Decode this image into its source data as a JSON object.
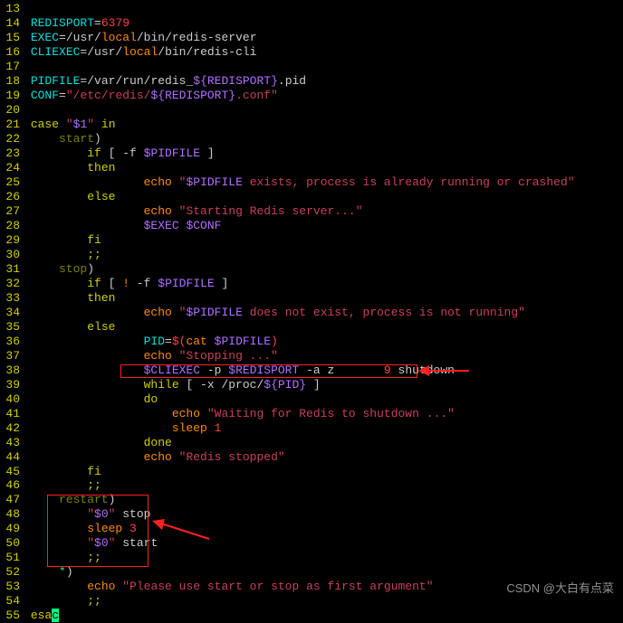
{
  "lines": [
    {
      "n": "13",
      "spans": []
    },
    {
      "n": "14",
      "spans": [
        {
          "t": " ",
          "c": "c-default"
        },
        {
          "t": "REDISPORT",
          "c": "c-cyan"
        },
        {
          "t": "=",
          "c": "c-default"
        },
        {
          "t": "6379",
          "c": "c-red"
        }
      ]
    },
    {
      "n": "15",
      "spans": [
        {
          "t": " ",
          "c": "c-default"
        },
        {
          "t": "EXEC",
          "c": "c-cyan"
        },
        {
          "t": "=",
          "c": "c-default"
        },
        {
          "t": "/usr/",
          "c": "c-default"
        },
        {
          "t": "local",
          "c": "c-orange"
        },
        {
          "t": "/bin/redis-server",
          "c": "c-default"
        }
      ]
    },
    {
      "n": "16",
      "spans": [
        {
          "t": " ",
          "c": "c-default"
        },
        {
          "t": "CLIEXEC",
          "c": "c-cyan"
        },
        {
          "t": "=",
          "c": "c-default"
        },
        {
          "t": "/usr/",
          "c": "c-default"
        },
        {
          "t": "local",
          "c": "c-orange"
        },
        {
          "t": "/bin/redis-cli",
          "c": "c-default"
        }
      ]
    },
    {
      "n": "17",
      "spans": []
    },
    {
      "n": "18",
      "spans": [
        {
          "t": " ",
          "c": "c-default"
        },
        {
          "t": "PIDFILE",
          "c": "c-cyan"
        },
        {
          "t": "=",
          "c": "c-default"
        },
        {
          "t": "/var/run/redis_",
          "c": "c-default"
        },
        {
          "t": "${REDISPORT}",
          "c": "c-purple"
        },
        {
          "t": ".pid",
          "c": "c-default"
        }
      ]
    },
    {
      "n": "19",
      "spans": [
        {
          "t": " ",
          "c": "c-default"
        },
        {
          "t": "CONF",
          "c": "c-cyan"
        },
        {
          "t": "=",
          "c": "c-default"
        },
        {
          "t": "\"/etc/redis/",
          "c": "c-string"
        },
        {
          "t": "${REDISPORT}",
          "c": "c-purple"
        },
        {
          "t": ".conf\"",
          "c": "c-string"
        }
      ]
    },
    {
      "n": "20",
      "spans": []
    },
    {
      "n": "21",
      "spans": [
        {
          "t": " ",
          "c": "c-default"
        },
        {
          "t": "case",
          "c": "c-yellow"
        },
        {
          "t": " ",
          "c": "c-default"
        },
        {
          "t": "\"",
          "c": "c-string"
        },
        {
          "t": "$1",
          "c": "c-purple"
        },
        {
          "t": "\"",
          "c": "c-string"
        },
        {
          "t": " ",
          "c": "c-default"
        },
        {
          "t": "in",
          "c": "c-yellow"
        }
      ]
    },
    {
      "n": "22",
      "spans": [
        {
          "t": "     ",
          "c": "c-default"
        },
        {
          "t": "start",
          "c": "c-olive"
        },
        {
          "t": ")",
          "c": "c-default"
        }
      ]
    },
    {
      "n": "23",
      "spans": [
        {
          "t": "         ",
          "c": "c-default"
        },
        {
          "t": "if",
          "c": "c-yellow"
        },
        {
          "t": " [ -f ",
          "c": "c-default"
        },
        {
          "t": "$PIDFILE",
          "c": "c-purple"
        },
        {
          "t": " ]",
          "c": "c-default"
        }
      ]
    },
    {
      "n": "24",
      "spans": [
        {
          "t": "         ",
          "c": "c-default"
        },
        {
          "t": "then",
          "c": "c-yellow"
        }
      ]
    },
    {
      "n": "25",
      "spans": [
        {
          "t": "                 ",
          "c": "c-default"
        },
        {
          "t": "echo",
          "c": "c-orange"
        },
        {
          "t": " ",
          "c": "c-default"
        },
        {
          "t": "\"",
          "c": "c-string"
        },
        {
          "t": "$PIDFILE",
          "c": "c-purple"
        },
        {
          "t": " exists, process is already running or crashed\"",
          "c": "c-string"
        }
      ]
    },
    {
      "n": "26",
      "spans": [
        {
          "t": "         ",
          "c": "c-default"
        },
        {
          "t": "else",
          "c": "c-yellow"
        }
      ]
    },
    {
      "n": "27",
      "spans": [
        {
          "t": "                 ",
          "c": "c-default"
        },
        {
          "t": "echo",
          "c": "c-orange"
        },
        {
          "t": " ",
          "c": "c-default"
        },
        {
          "t": "\"Starting Redis server...\"",
          "c": "c-string"
        }
      ]
    },
    {
      "n": "28",
      "spans": [
        {
          "t": "                 ",
          "c": "c-default"
        },
        {
          "t": "$EXEC",
          "c": "c-purple"
        },
        {
          "t": " ",
          "c": "c-default"
        },
        {
          "t": "$CONF",
          "c": "c-purple"
        }
      ]
    },
    {
      "n": "29",
      "spans": [
        {
          "t": "         ",
          "c": "c-default"
        },
        {
          "t": "fi",
          "c": "c-yellow"
        }
      ]
    },
    {
      "n": "30",
      "spans": [
        {
          "t": "         ",
          "c": "c-default"
        },
        {
          "t": ";;",
          "c": "c-yellow"
        }
      ]
    },
    {
      "n": "31",
      "spans": [
        {
          "t": "     ",
          "c": "c-default"
        },
        {
          "t": "stop",
          "c": "c-olive"
        },
        {
          "t": ")",
          "c": "c-default"
        }
      ]
    },
    {
      "n": "32",
      "spans": [
        {
          "t": "         ",
          "c": "c-default"
        },
        {
          "t": "if",
          "c": "c-yellow"
        },
        {
          "t": " [ ",
          "c": "c-default"
        },
        {
          "t": "!",
          "c": "c-orange"
        },
        {
          "t": " -f ",
          "c": "c-default"
        },
        {
          "t": "$PIDFILE",
          "c": "c-purple"
        },
        {
          "t": " ]",
          "c": "c-default"
        }
      ]
    },
    {
      "n": "33",
      "spans": [
        {
          "t": "         ",
          "c": "c-default"
        },
        {
          "t": "then",
          "c": "c-yellow"
        }
      ]
    },
    {
      "n": "34",
      "spans": [
        {
          "t": "                 ",
          "c": "c-default"
        },
        {
          "t": "echo",
          "c": "c-orange"
        },
        {
          "t": " ",
          "c": "c-default"
        },
        {
          "t": "\"",
          "c": "c-string"
        },
        {
          "t": "$PIDFILE",
          "c": "c-purple"
        },
        {
          "t": " does not exist, process is not running\"",
          "c": "c-string"
        }
      ]
    },
    {
      "n": "35",
      "spans": [
        {
          "t": "         ",
          "c": "c-default"
        },
        {
          "t": "else",
          "c": "c-yellow"
        }
      ]
    },
    {
      "n": "36",
      "spans": [
        {
          "t": "                 ",
          "c": "c-default"
        },
        {
          "t": "PID",
          "c": "c-cyan"
        },
        {
          "t": "=",
          "c": "c-default"
        },
        {
          "t": "$(",
          "c": "c-red"
        },
        {
          "t": "cat ",
          "c": "c-orange"
        },
        {
          "t": "$PIDFILE",
          "c": "c-purple"
        },
        {
          "t": ")",
          "c": "c-red"
        }
      ]
    },
    {
      "n": "37",
      "spans": [
        {
          "t": "                 ",
          "c": "c-default"
        },
        {
          "t": "echo",
          "c": "c-orange"
        },
        {
          "t": " ",
          "c": "c-default"
        },
        {
          "t": "\"Stopping ...\"",
          "c": "c-string"
        }
      ]
    },
    {
      "n": "38",
      "spans": [
        {
          "t": "                 ",
          "c": "c-default"
        },
        {
          "t": "$CLIEXEC",
          "c": "c-purple"
        },
        {
          "t": " -p ",
          "c": "c-default"
        },
        {
          "t": "$REDISPORT",
          "c": "c-purple"
        },
        {
          "t": " -a z",
          "c": "c-default"
        },
        {
          "t": "       ",
          "c": "c-default"
        },
        {
          "t": "9",
          "c": "c-red"
        },
        {
          "t": " shutdown",
          "c": "c-default"
        }
      ]
    },
    {
      "n": "39",
      "spans": [
        {
          "t": "                 ",
          "c": "c-default"
        },
        {
          "t": "while",
          "c": "c-yellow"
        },
        {
          "t": " [ -x /proc/",
          "c": "c-default"
        },
        {
          "t": "${PID}",
          "c": "c-purple"
        },
        {
          "t": " ]",
          "c": "c-default"
        }
      ]
    },
    {
      "n": "40",
      "spans": [
        {
          "t": "                 ",
          "c": "c-default"
        },
        {
          "t": "do",
          "c": "c-yellow"
        }
      ]
    },
    {
      "n": "41",
      "spans": [
        {
          "t": "                     ",
          "c": "c-default"
        },
        {
          "t": "echo",
          "c": "c-orange"
        },
        {
          "t": " ",
          "c": "c-default"
        },
        {
          "t": "\"Waiting for Redis to shutdown ...\"",
          "c": "c-string"
        }
      ]
    },
    {
      "n": "42",
      "spans": [
        {
          "t": "                     ",
          "c": "c-default"
        },
        {
          "t": "sleep",
          "c": "c-orange"
        },
        {
          "t": " ",
          "c": "c-default"
        },
        {
          "t": "1",
          "c": "c-red"
        }
      ]
    },
    {
      "n": "43",
      "spans": [
        {
          "t": "                 ",
          "c": "c-default"
        },
        {
          "t": "done",
          "c": "c-yellow"
        }
      ]
    },
    {
      "n": "44",
      "spans": [
        {
          "t": "                 ",
          "c": "c-default"
        },
        {
          "t": "echo",
          "c": "c-orange"
        },
        {
          "t": " ",
          "c": "c-default"
        },
        {
          "t": "\"Redis stopped\"",
          "c": "c-string"
        }
      ]
    },
    {
      "n": "45",
      "spans": [
        {
          "t": "         ",
          "c": "c-default"
        },
        {
          "t": "fi",
          "c": "c-yellow"
        }
      ]
    },
    {
      "n": "46",
      "spans": [
        {
          "t": "         ",
          "c": "c-default"
        },
        {
          "t": ";;",
          "c": "c-yellow"
        }
      ]
    },
    {
      "n": "47",
      "spans": [
        {
          "t": "     ",
          "c": "c-default"
        },
        {
          "t": "restart",
          "c": "c-olive"
        },
        {
          "t": ")",
          "c": "c-default"
        }
      ]
    },
    {
      "n": "48",
      "spans": [
        {
          "t": "         ",
          "c": "c-default"
        },
        {
          "t": "\"",
          "c": "c-string"
        },
        {
          "t": "$0",
          "c": "c-purple"
        },
        {
          "t": "\"",
          "c": "c-string"
        },
        {
          "t": " stop",
          "c": "c-default"
        }
      ]
    },
    {
      "n": "49",
      "spans": [
        {
          "t": "         ",
          "c": "c-default"
        },
        {
          "t": "sleep",
          "c": "c-orange"
        },
        {
          "t": " ",
          "c": "c-default"
        },
        {
          "t": "3",
          "c": "c-red"
        }
      ]
    },
    {
      "n": "50",
      "spans": [
        {
          "t": "         ",
          "c": "c-default"
        },
        {
          "t": "\"",
          "c": "c-string"
        },
        {
          "t": "$0",
          "c": "c-purple"
        },
        {
          "t": "\"",
          "c": "c-string"
        },
        {
          "t": " start",
          "c": "c-default"
        }
      ]
    },
    {
      "n": "51",
      "spans": [
        {
          "t": "         ",
          "c": "c-default"
        },
        {
          "t": ";;",
          "c": "c-yellow"
        }
      ]
    },
    {
      "n": "52",
      "spans": [
        {
          "t": "     ",
          "c": "c-default"
        },
        {
          "t": "*",
          "c": "c-green"
        },
        {
          "t": ")",
          "c": "c-default"
        }
      ]
    },
    {
      "n": "53",
      "spans": [
        {
          "t": "         ",
          "c": "c-default"
        },
        {
          "t": "echo",
          "c": "c-orange"
        },
        {
          "t": " ",
          "c": "c-default"
        },
        {
          "t": "\"Please use start or stop as first argument\"",
          "c": "c-string"
        }
      ]
    },
    {
      "n": "54",
      "spans": [
        {
          "t": "         ",
          "c": "c-default"
        },
        {
          "t": ";;",
          "c": "c-yellow"
        }
      ]
    },
    {
      "n": "55",
      "spans": [
        {
          "t": " ",
          "c": "c-default"
        },
        {
          "t": "esa",
          "c": "c-yellow"
        },
        {
          "t": "c",
          "c": "cursor-bg"
        }
      ]
    }
  ],
  "watermark": "CSDN @大白有点菜"
}
